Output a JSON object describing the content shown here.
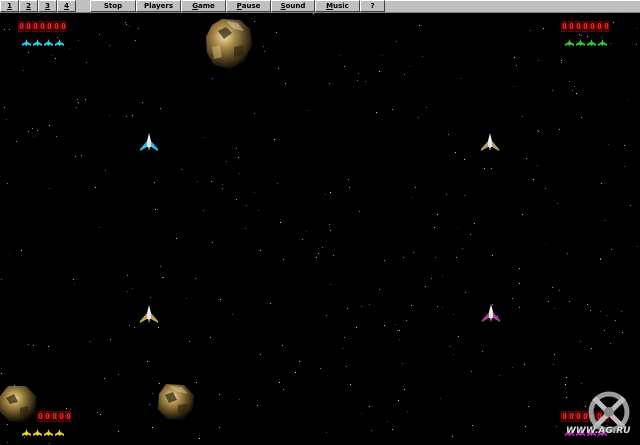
{
  "menu": {
    "items": [
      {
        "label": "1",
        "underline": "1"
      },
      {
        "label": "2",
        "underline": "2"
      },
      {
        "label": "3",
        "underline": "3"
      },
      {
        "label": "4",
        "underline": "4"
      },
      {
        "label": "Stop",
        "underline": ""
      },
      {
        "label": "Players",
        "underline": ""
      },
      {
        "label": "Game",
        "underline": "G"
      },
      {
        "label": "Pause",
        "underline": "P"
      },
      {
        "label": "Sound",
        "underline": "S"
      },
      {
        "label": "Music",
        "underline": "M"
      },
      {
        "label": "?",
        "underline": ""
      }
    ]
  },
  "players": [
    {
      "id": "top-left",
      "score": "0000000",
      "lives": 4,
      "color": "#27d3e6"
    },
    {
      "id": "top-right",
      "score": "0000000",
      "lives": 4,
      "color": "#2ed12e"
    },
    {
      "id": "bottom-left",
      "score": "00000",
      "lives": 4,
      "color": "#e6d62a"
    },
    {
      "id": "bottom-right",
      "score": "0000000",
      "lives": 4,
      "color": "#d62ad6"
    }
  ],
  "ships": [
    {
      "id": "ship-cyan",
      "color": "#3ab8d8"
    },
    {
      "id": "ship-olive",
      "color": "#a9a36a"
    },
    {
      "id": "ship-gold",
      "color": "#c2a052"
    },
    {
      "id": "ship-magenta",
      "color": "#b03aa0"
    }
  ],
  "watermark": {
    "text": "WWW.AG.RU"
  }
}
